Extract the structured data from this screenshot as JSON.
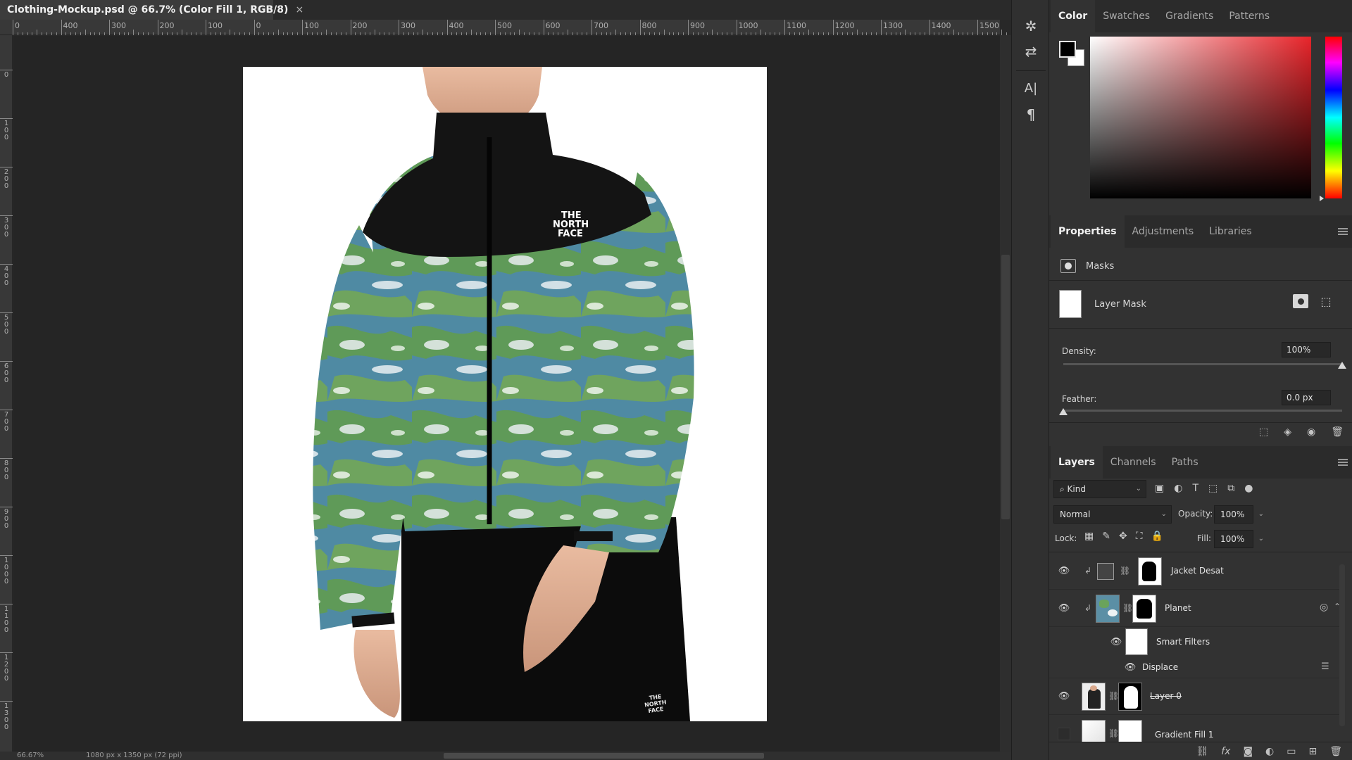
{
  "document": {
    "tab_title": "Clothing-Mockup.psd @ 66.7% (Color Fill 1, RGB/8)",
    "close_glyph": "×"
  },
  "rulers": {
    "horizontal_labels": [
      "0",
      "400",
      "300",
      "200",
      "100",
      "0",
      "100",
      "200",
      "300",
      "400",
      "500",
      "600",
      "700",
      "800",
      "900",
      "1000",
      "1100",
      "1200",
      "1300",
      "1400",
      "1500"
    ],
    "vertical_labels": [
      "0",
      "100",
      "200",
      "300",
      "400",
      "500",
      "600",
      "700",
      "800",
      "900",
      "1000",
      "1100",
      "1200",
      "1300"
    ]
  },
  "status_bar": {
    "zoom": "66.67%",
    "doc_size": "1080 px x 1350 px (72 ppi)"
  },
  "artwork": {
    "logo_chest": [
      "THE",
      "NORTH",
      "FACE"
    ],
    "logo_pants": [
      "THE",
      "NORTH",
      "FACE"
    ]
  },
  "tools": [
    {
      "name": "puppet-warp-icon",
      "glyph": "✲"
    },
    {
      "name": "adjust-icon",
      "glyph": "⇄"
    },
    {
      "name": "character-icon",
      "glyph": "A|"
    },
    {
      "name": "paragraph-icon",
      "glyph": "¶"
    }
  ],
  "color_panel": {
    "tabs": [
      "Color",
      "Swatches",
      "Gradients",
      "Patterns"
    ],
    "active_tab": "Color",
    "foreground": "#000000",
    "background": "#ffffff",
    "field_hue": "#e8242a"
  },
  "properties_panel": {
    "tabs": [
      "Properties",
      "Adjustments",
      "Libraries"
    ],
    "active_tab": "Properties",
    "section": "Masks",
    "mask_label": "Layer Mask",
    "density_label": "Density:",
    "density_value": "100%",
    "density_percent": 100,
    "feather_label": "Feather:",
    "feather_value": "0.0 px",
    "feather_percent": 0
  },
  "layers_panel": {
    "tabs": [
      "Layers",
      "Channels",
      "Paths"
    ],
    "active_tab": "Layers",
    "filter_kind": "Kind",
    "blend_mode": "Normal",
    "opacity_label": "Opacity:",
    "opacity_value": "100%",
    "lock_label": "Lock:",
    "fill_label": "Fill:",
    "fill_value": "100%",
    "layers": [
      {
        "name": "Jacket Desat",
        "visible": true
      },
      {
        "name": "Planet",
        "visible": true
      },
      {
        "name": "Smart Filters",
        "visible": true
      },
      {
        "name": "Displace",
        "visible": true
      },
      {
        "name": "Layer 0",
        "visible": true
      },
      {
        "name": "Gradient Fill 1",
        "visible": false
      }
    ],
    "footer_icons": [
      "link-icon",
      "fx-icon",
      "mask-icon",
      "adjustment-icon",
      "group-icon",
      "new-layer-icon",
      "trash-icon"
    ]
  }
}
